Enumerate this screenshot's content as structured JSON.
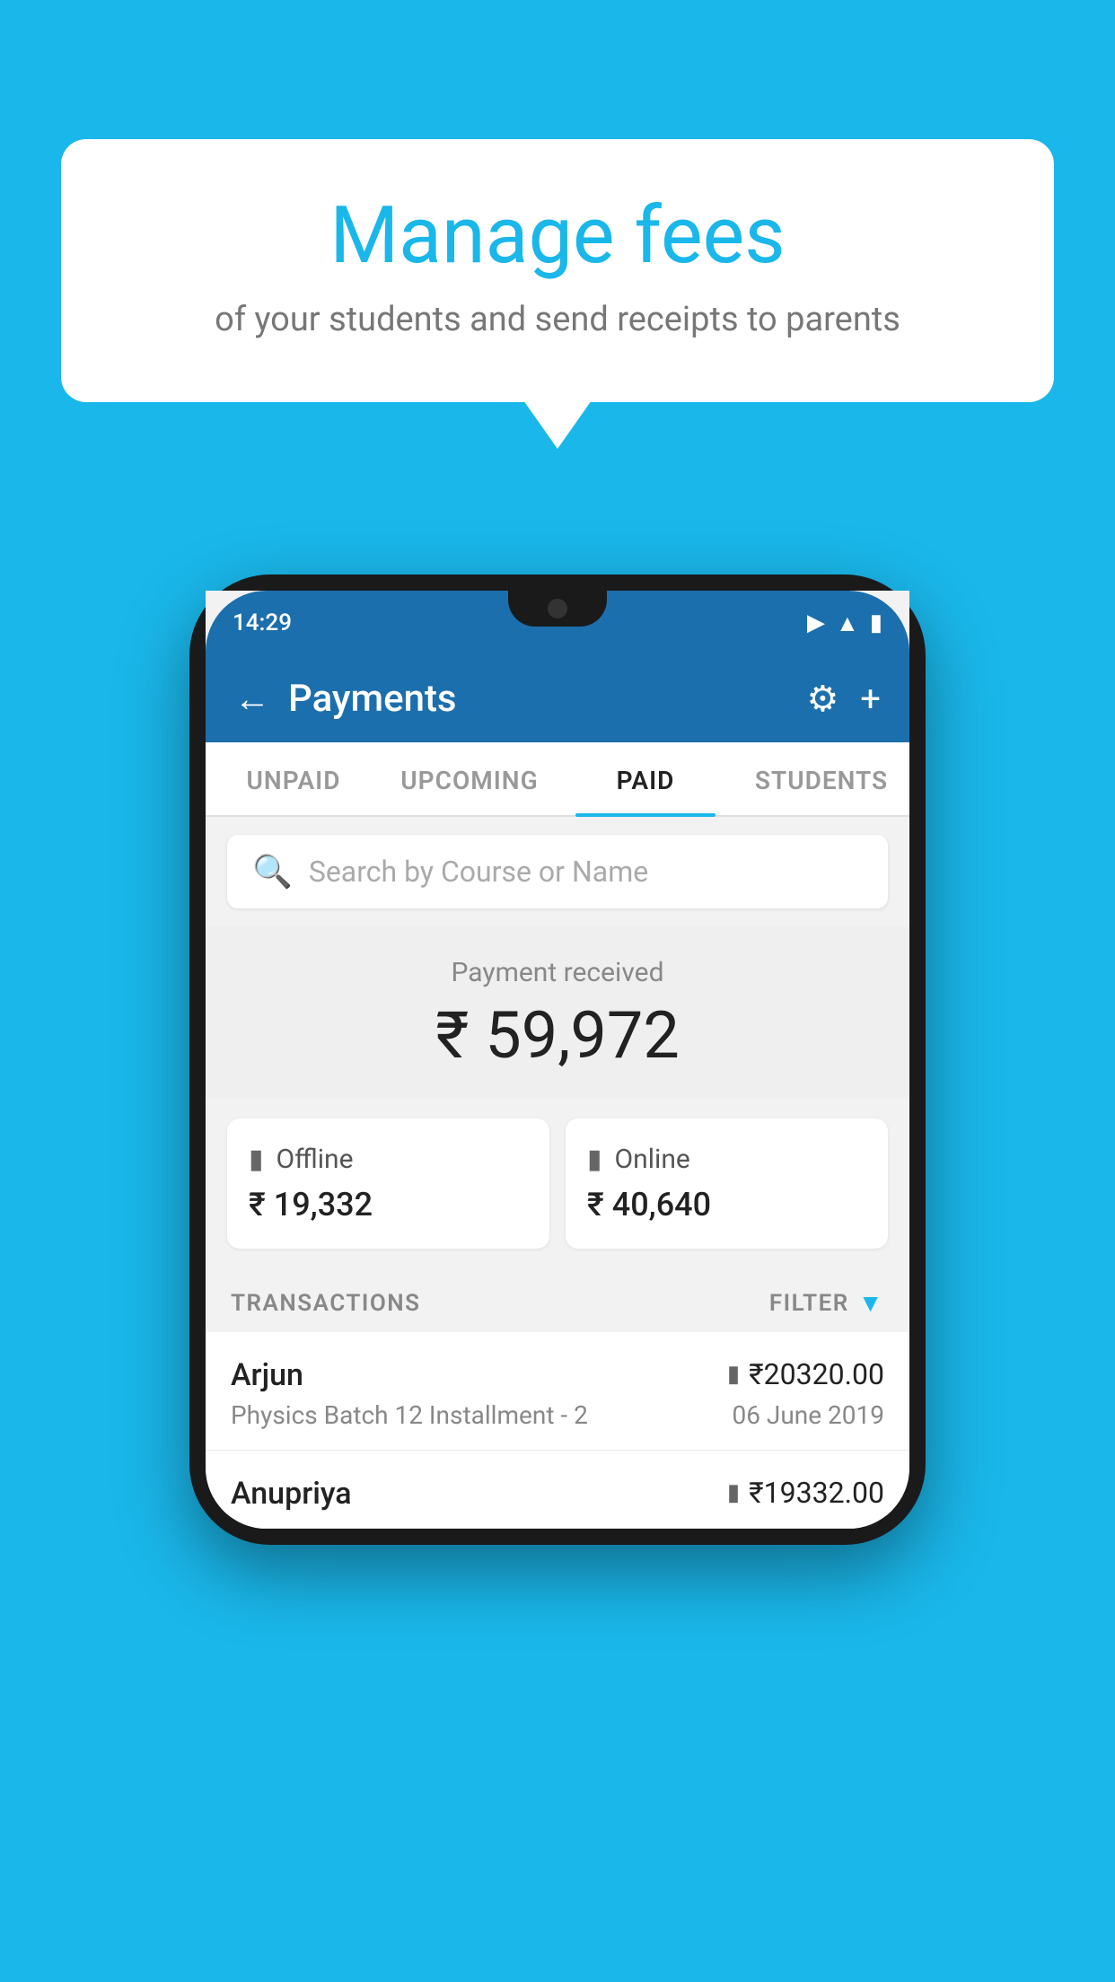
{
  "background_color": "#1ab7ea",
  "bubble": {
    "title": "Manage fees",
    "subtitle": "of your students and send receipts to parents"
  },
  "phone": {
    "status_bar": {
      "time": "14:29",
      "wifi": "▼",
      "signal": "▲",
      "battery": "▪"
    },
    "header": {
      "title": "Payments",
      "back_label": "←",
      "gear_label": "⚙",
      "plus_label": "+"
    },
    "tabs": [
      {
        "label": "UNPAID",
        "active": false
      },
      {
        "label": "UPCOMING",
        "active": false
      },
      {
        "label": "PAID",
        "active": true
      },
      {
        "label": "STUDENTS",
        "active": false
      }
    ],
    "search": {
      "placeholder": "Search by Course or Name"
    },
    "payment_summary": {
      "label": "Payment received",
      "amount": "₹ 59,972",
      "offline_label": "Offline",
      "offline_amount": "₹ 19,332",
      "online_label": "Online",
      "online_amount": "₹ 40,640"
    },
    "transactions": {
      "header_label": "TRANSACTIONS",
      "filter_label": "FILTER",
      "items": [
        {
          "name": "Arjun",
          "amount": "₹20320.00",
          "course": "Physics Batch 12 Installment - 2",
          "date": "06 June 2019",
          "payment_type": "online"
        },
        {
          "name": "Anupriya",
          "amount": "₹19332.00",
          "course": "",
          "date": "",
          "payment_type": "offline"
        }
      ]
    }
  }
}
